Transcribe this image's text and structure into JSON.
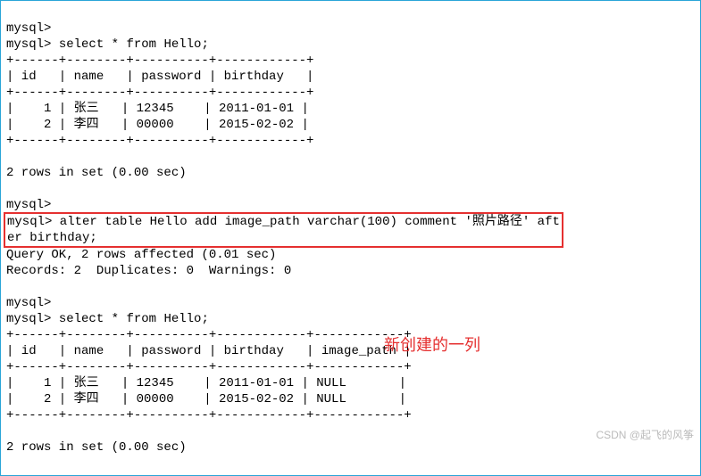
{
  "prompt": "mysql>",
  "query1": "select * from Hello;",
  "table1": {
    "sep": "+------+--------+----------+------------+",
    "head": "| id   | name   | password | birthday   |",
    "rows": [
      "|    1 | 张三   | 12345    | 2011-01-01 |",
      "|    2 | 李四   | 00000    | 2015-02-02 |"
    ],
    "footer": "2 rows in set (0.00 sec)"
  },
  "alter": {
    "line1": "mysql> alter table Hello add image_path varchar(100) comment '照片路径' aft",
    "line2": "er birthday;"
  },
  "alter_result": {
    "l1": "Query OK, 2 rows affected (0.01 sec)",
    "l2": "Records: 2  Duplicates: 0  Warnings: 0"
  },
  "query2": "select * from Hello;",
  "annotation": "新创建的一列",
  "table2": {
    "sep": "+------+--------+----------+------------+------------+",
    "head": "| id   | name   | password | birthday   | image_path |",
    "rows": [
      "|    1 | 张三   | 12345    | 2011-01-01 | NULL       |",
      "|    2 | 李四   | 00000    | 2015-02-02 | NULL       |"
    ],
    "footer": "2 rows in set (0.00 sec)"
  },
  "watermark": "CSDN @起飞的风筝"
}
